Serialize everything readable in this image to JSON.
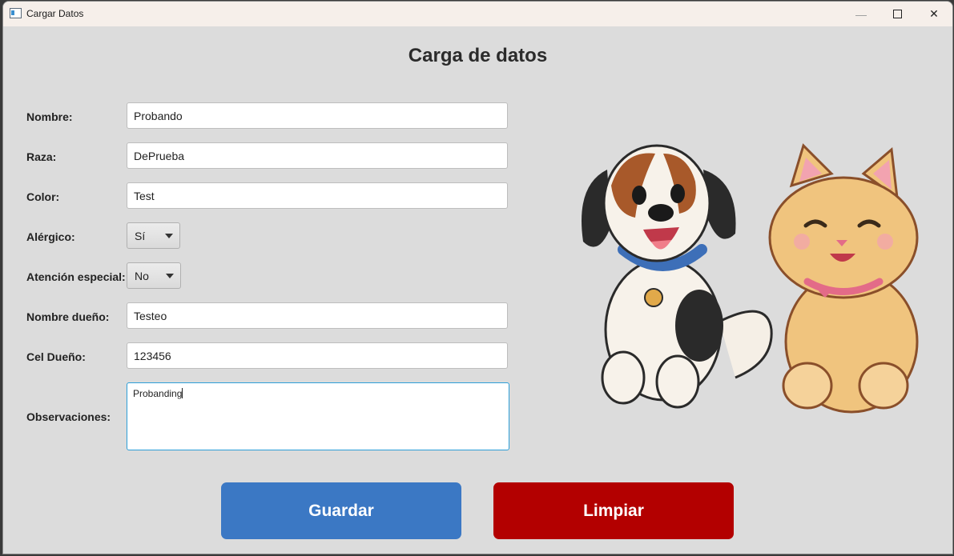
{
  "window": {
    "title": "Cargar Datos"
  },
  "form": {
    "heading": "Carga de datos",
    "fields": {
      "nombre": {
        "label": "Nombre:",
        "value": "Probando"
      },
      "raza": {
        "label": "Raza:",
        "value": "DePrueba"
      },
      "color": {
        "label": "Color:",
        "value": "Test"
      },
      "alergico": {
        "label": "Alérgico:",
        "value": "Sí"
      },
      "atencion": {
        "label": "Atención especial:",
        "value": "No"
      },
      "nombre_dueno": {
        "label": "Nombre dueño:",
        "value": "Testeo"
      },
      "cel_dueno": {
        "label": "Cel Dueño:",
        "value": "123456"
      },
      "observaciones": {
        "label": "Observaciones:",
        "value": "Probanding"
      }
    }
  },
  "buttons": {
    "save": "Guardar",
    "clear": "Limpiar"
  },
  "colors": {
    "save": "#3b78c4",
    "clear": "#b30000",
    "focus": "#2c9ed8"
  },
  "icons": [
    "app-window-icon",
    "minimize-icon",
    "maximize-icon",
    "close-icon",
    "chevron-down-icon",
    "dog-cat-illustration"
  ]
}
